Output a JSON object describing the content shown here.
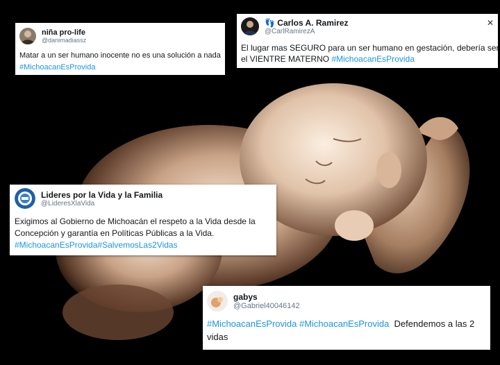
{
  "tweets": [
    {
      "name": "niña pro-life",
      "handle": "@danimadiassz",
      "text": "Matar a un ser humano inocente no es una solución a nada",
      "hashtags": "#MichoacanEsProvida"
    },
    {
      "name": "Carlos A. Ramirez",
      "handle": "@CarlRamirezA",
      "text": "El lugar mas SEGURO para un ser humano en gestación, debería ser",
      "text2": "el VIENTRE MATERNO",
      "hashtags": "#MichoacanEsProvida"
    },
    {
      "name": "Lideres por la Vida y la Familia",
      "handle": "@LideresXlaVida",
      "text": "Exigimos al Gobierno de Michoacán el respeto a la Vida desde la Concepción y garantía en Políticas Públicas a la Vida.",
      "hashtags": "#MichoacanEsProvida#SalvemosLas2Vidas"
    },
    {
      "name": "gabys",
      "handle": "@Gabriel40046142",
      "hashtags": "#MichoacanEsProvida #MichoacanEsProvida",
      "text": "Defendemos a las 2 vidas"
    }
  ],
  "colors": {
    "link": "#1b95e0",
    "handle": "#657786",
    "background": "#000000"
  },
  "icons": [
    "avatar-photo",
    "logo-circle",
    "close-icon"
  ]
}
